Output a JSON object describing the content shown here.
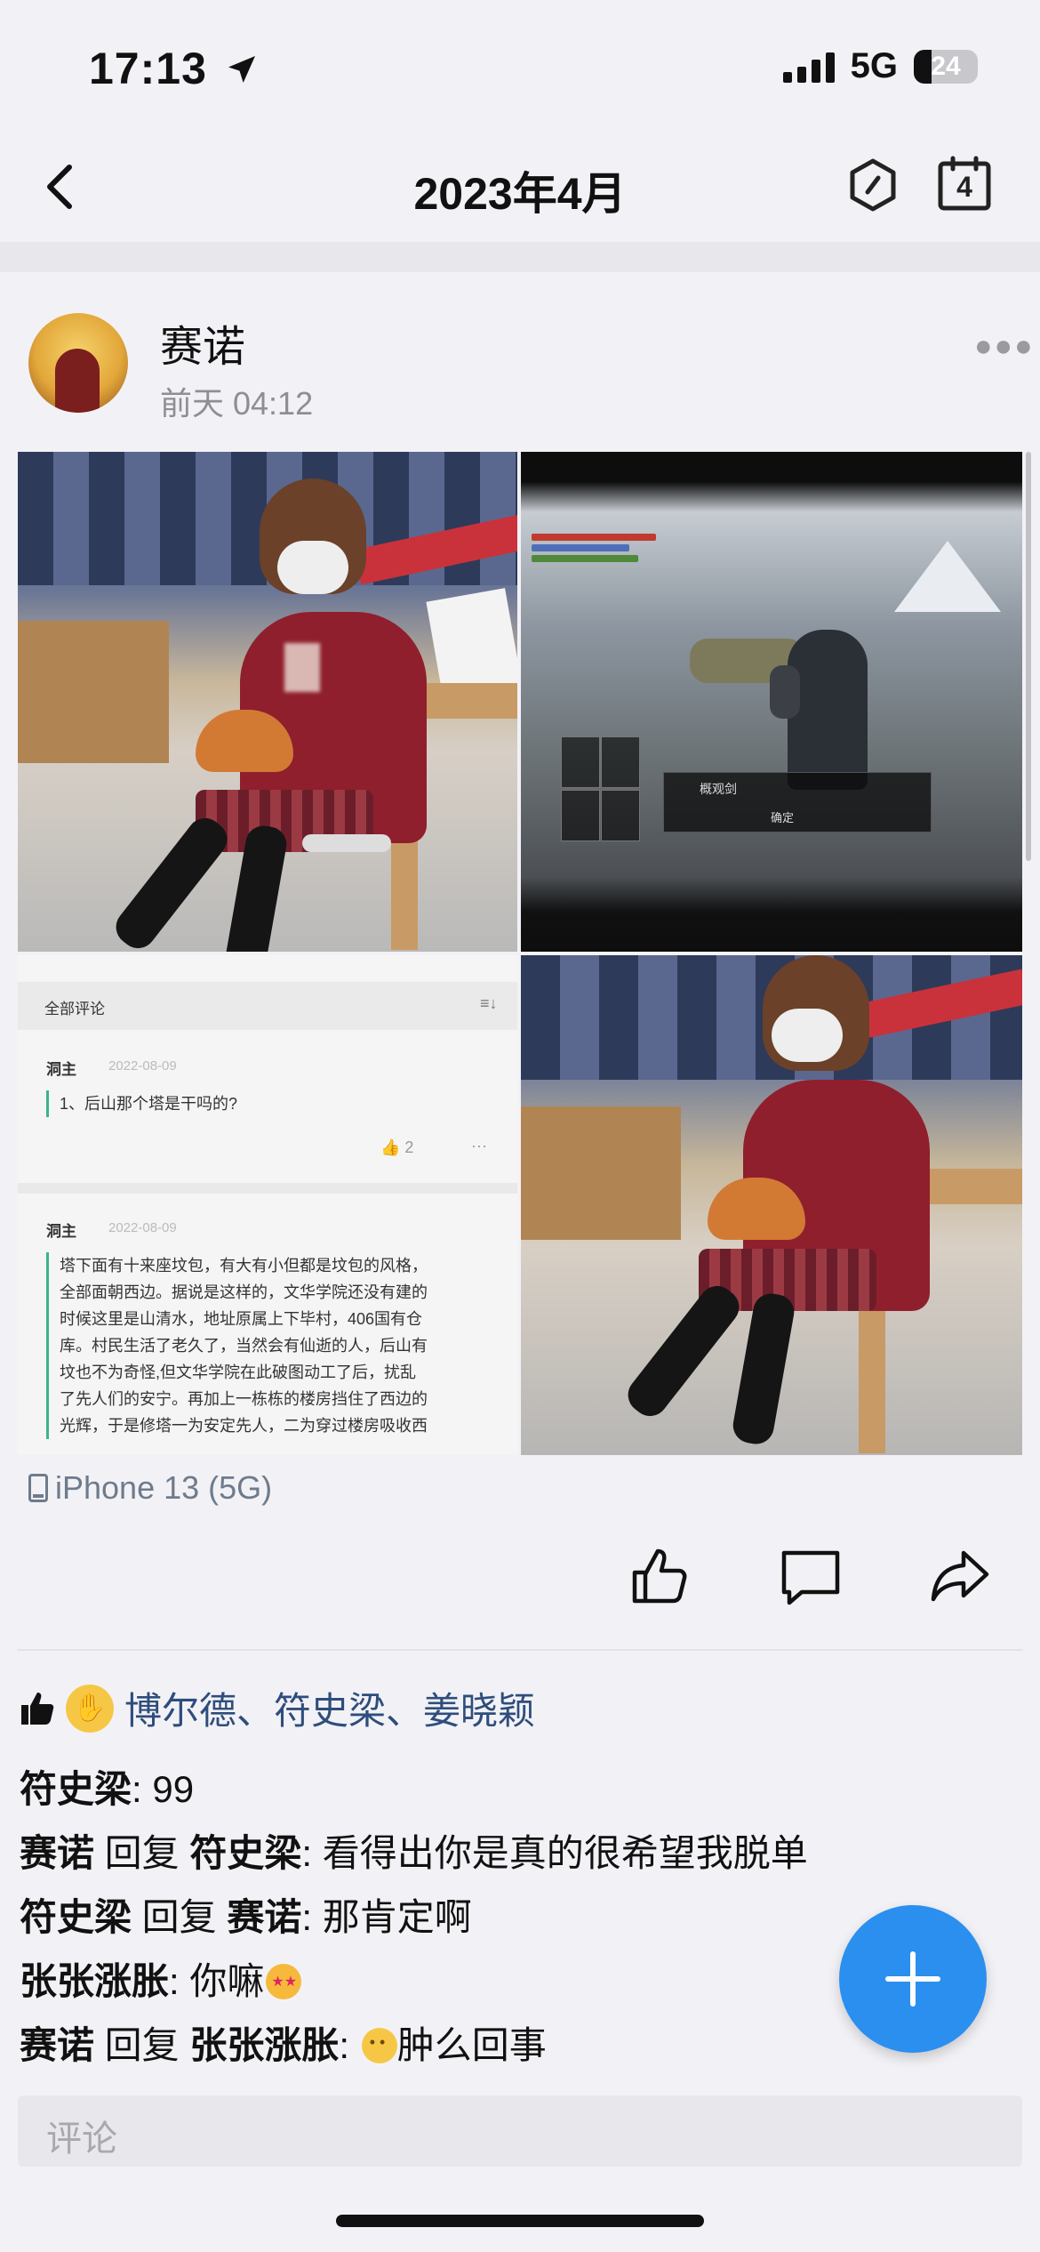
{
  "status_bar": {
    "time": "17:13",
    "network": "5G",
    "battery": "24"
  },
  "nav": {
    "title": "2023年4月",
    "calendar_day": "4"
  },
  "post": {
    "author": "赛诺",
    "time": "前天 04:12",
    "device": "iPhone 13 (5G)",
    "comment_screenshot": {
      "header": "全部评论",
      "first": {
        "user": "洞主",
        "date": "2022-08-09",
        "text": "1、后山那个塔是干吗的?",
        "likes": "2"
      },
      "second": {
        "user": "洞主",
        "date": "2022-08-09",
        "lines": [
          "塔下面有十来座坟包，有大有小但都是坟包的风格，",
          "全部面朝西边。据说是这样的，文华学院还没有建的",
          "时候这里是山清水，地址原属上下毕村，406国有仓",
          "库。村民生活了老久了，当然会有仙逝的人，后山有",
          "坟也不为奇怪,但文华学院在此破图动工了后，扰乱",
          "了先人们的安宁。再加上一栋栋的楼房挡住了西边的",
          "光辉，于是修塔一为安定先人，二为穿过楼房吸收西"
        ]
      }
    },
    "game_dialog": {
      "text": "概观剑",
      "confirm": "确定"
    },
    "likes": "博尔德、符史梁、姜晓颖",
    "comments": [
      {
        "author": "符史梁",
        "reply_to": "",
        "text": ": 99"
      },
      {
        "author": "赛诺",
        "reply_word": " 回复 ",
        "reply_to": "符史梁",
        "text": ": 看得出你是真的很希望我脱单"
      },
      {
        "author": "符史梁",
        "reply_word": " 回复 ",
        "reply_to": "赛诺",
        "text": ": 那肯定啊"
      },
      {
        "author": "张张涨胀",
        "reply_to": "",
        "text": ": 你嘛"
      },
      {
        "author": "赛诺",
        "reply_word": " 回复 ",
        "reply_to": "张张涨胀",
        "text": ": ",
        "tail": "肿么回事"
      }
    ],
    "comment_placeholder": "评论"
  },
  "colors": {
    "accent": "#2b8ff0",
    "link": "#2f4d7c",
    "background": "#f2f2f6"
  },
  "icons": [
    "location-arrow-icon",
    "signal-icon",
    "battery-icon",
    "back-chevron-icon",
    "hexagon-icon",
    "calendar-icon",
    "more-icon",
    "phone-icon",
    "like-icon",
    "comment-icon",
    "share-icon",
    "thumb-icon",
    "plus-icon"
  ]
}
